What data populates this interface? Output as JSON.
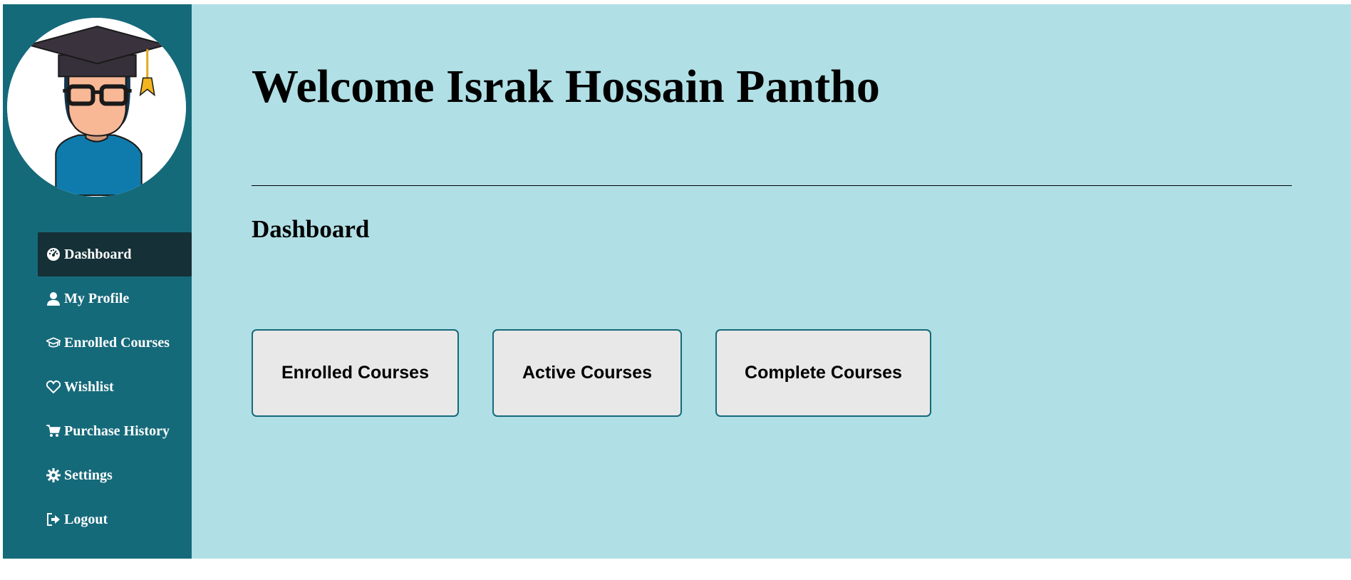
{
  "sidebar": {
    "items": [
      {
        "label": "Dashboard",
        "icon": "dashboard-icon",
        "active": true
      },
      {
        "label": "My Profile",
        "icon": "user-icon"
      },
      {
        "label": "Enrolled Courses",
        "icon": "graduation-cap-icon"
      },
      {
        "label": "Wishlist",
        "icon": "heart-icon"
      },
      {
        "label": "Purchase History",
        "icon": "cart-icon"
      },
      {
        "label": "Settings",
        "icon": "gear-icon"
      },
      {
        "label": "Logout",
        "icon": "logout-icon"
      }
    ]
  },
  "main": {
    "welcome": "Welcome Israk Hossain Pantho",
    "section_title": "Dashboard",
    "cards": [
      {
        "label": "Enrolled Courses"
      },
      {
        "label": "Active Courses"
      },
      {
        "label": "Complete Courses"
      }
    ]
  },
  "colors": {
    "sidebar_bg": "#156a7a",
    "sidebar_active_bg": "#153036",
    "main_bg": "#b0dfe5",
    "card_bg": "#e8e8e8"
  }
}
